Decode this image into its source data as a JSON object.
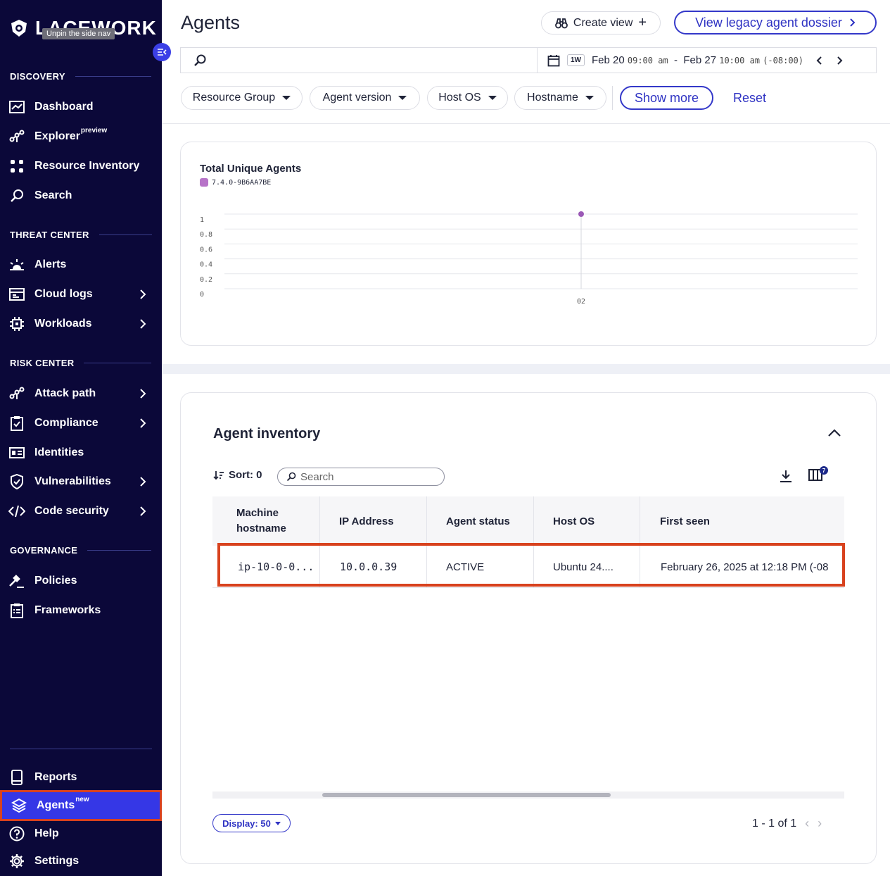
{
  "sidebar": {
    "logo_text": "LACEWORK",
    "tooltip": "Unpin the side nav",
    "sections": {
      "discovery": "DISCOVERY",
      "threat_center": "THREAT CENTER",
      "risk_center": "RISK CENTER",
      "governance": "GOVERNANCE"
    },
    "items": {
      "dashboard": "Dashboard",
      "explorer": "Explorer",
      "explorer_badge": "preview",
      "resource_inventory": "Resource Inventory",
      "search": "Search",
      "alerts": "Alerts",
      "cloud_logs": "Cloud logs",
      "workloads": "Workloads",
      "attack_path": "Attack path",
      "compliance": "Compliance",
      "identities": "Identities",
      "vulnerabilities": "Vulnerabilities",
      "code_security": "Code security",
      "policies": "Policies",
      "frameworks": "Frameworks",
      "reports": "Reports",
      "agents": "Agents",
      "agents_badge": "new",
      "help": "Help",
      "settings": "Settings"
    }
  },
  "header": {
    "title": "Agents",
    "create_view": "Create view",
    "legacy_dossier": "View legacy agent dossier"
  },
  "timerange": {
    "preset": "1W",
    "start_date": "Feb 20",
    "start_time": "09:00 am",
    "separator": "-",
    "end_date": "Feb 27",
    "end_time": "10:00 am",
    "tz": "(-08:00)"
  },
  "filters": {
    "resource_group": "Resource Group",
    "agent_version": "Agent version",
    "host_os": "Host OS",
    "hostname": "Hostname",
    "show_more": "Show more",
    "reset": "Reset"
  },
  "chart_data": {
    "type": "scatter",
    "title": "Total Unique Agents",
    "series": [
      {
        "name": "7.4.0-9B6AA7BE",
        "color": "#9b59b6",
        "x": [
          "02"
        ],
        "values": [
          1
        ]
      }
    ],
    "y_ticks": [
      "1",
      "0.8",
      "0.6",
      "0.4",
      "0.2",
      "0"
    ],
    "x_ticks": [
      "02"
    ],
    "ylim": [
      0,
      1
    ],
    "grid": true,
    "legend_position": "top-left"
  },
  "inventory": {
    "title": "Agent inventory",
    "sort_label": "Sort: 0",
    "search_placeholder": "Search",
    "columns_badge": "7",
    "columns": [
      "Machine hostname",
      "IP Address",
      "Agent status",
      "Host OS",
      "First seen"
    ],
    "rows": [
      {
        "hostname": "ip-10-0-0...",
        "ip": "10.0.0.39",
        "status": "ACTIVE",
        "os": "Ubuntu 24....",
        "first_seen": "February 26, 2025 at 12:18 PM (-08"
      }
    ],
    "display": "Display: 50",
    "pager": "1 - 1 of 1"
  }
}
